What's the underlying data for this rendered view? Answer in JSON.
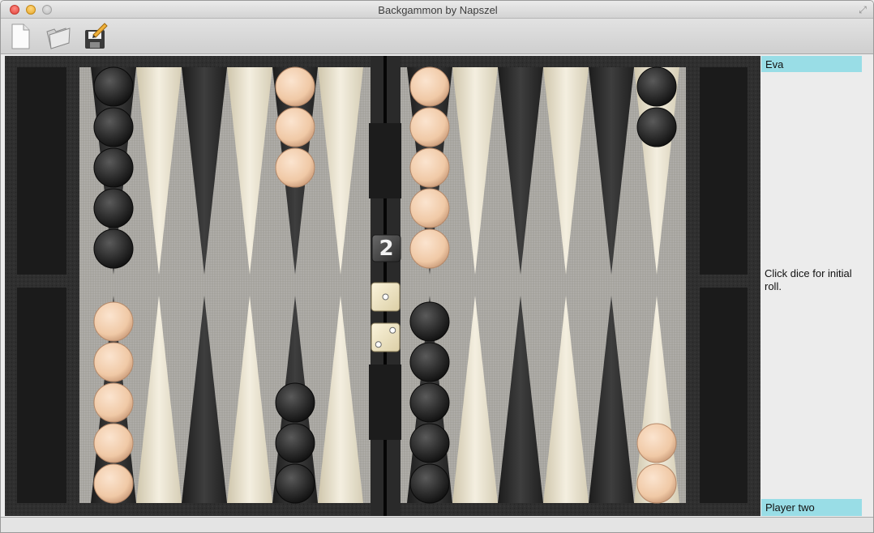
{
  "window": {
    "title": "Backgammon by Napszel"
  },
  "toolbar": {
    "buttons": [
      {
        "name": "new-game-button",
        "icon": "new-document-icon"
      },
      {
        "name": "open-game-button",
        "icon": "open-folder-icon"
      },
      {
        "name": "save-game-button",
        "icon": "save-disk-icon"
      }
    ]
  },
  "players": {
    "top_name": "Eva",
    "bottom_name": "Player two"
  },
  "status": {
    "message": "Click dice for initial roll."
  },
  "doubling_cube": {
    "value": "2"
  },
  "dice": [
    1,
    2
  ],
  "colors": {
    "player_label_bg": "#99dde6",
    "light_checker": "#f0c9a6",
    "dark_checker": "#2a2a2a"
  },
  "board": {
    "top_left_points": [
      {
        "color": "dark",
        "count": 5
      },
      {
        "color": "none",
        "count": 0
      },
      {
        "color": "none",
        "count": 0
      },
      {
        "color": "none",
        "count": 0
      },
      {
        "color": "light",
        "count": 3
      },
      {
        "color": "none",
        "count": 0
      }
    ],
    "top_right_points": [
      {
        "color": "light",
        "count": 5
      },
      {
        "color": "none",
        "count": 0
      },
      {
        "color": "none",
        "count": 0
      },
      {
        "color": "none",
        "count": 0
      },
      {
        "color": "none",
        "count": 0
      },
      {
        "color": "dark",
        "count": 2
      }
    ],
    "bottom_left_points": [
      {
        "color": "light",
        "count": 5
      },
      {
        "color": "none",
        "count": 0
      },
      {
        "color": "none",
        "count": 0
      },
      {
        "color": "none",
        "count": 0
      },
      {
        "color": "dark",
        "count": 3
      },
      {
        "color": "none",
        "count": 0
      }
    ],
    "bottom_right_points": [
      {
        "color": "dark",
        "count": 5
      },
      {
        "color": "none",
        "count": 0
      },
      {
        "color": "none",
        "count": 0
      },
      {
        "color": "none",
        "count": 0
      },
      {
        "color": "none",
        "count": 0
      },
      {
        "color": "light",
        "count": 2
      }
    ]
  }
}
